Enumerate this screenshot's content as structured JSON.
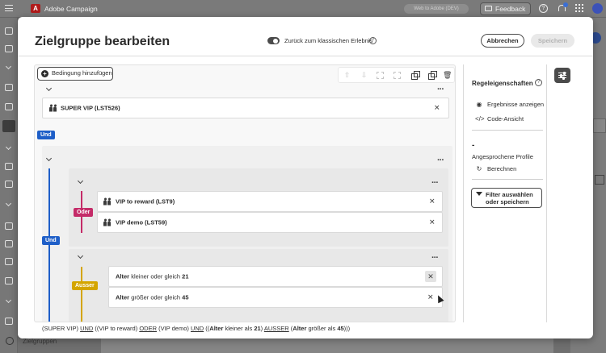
{
  "app": {
    "title": "Adobe Campaign",
    "org_selector": "Web to Adobe (DEV)",
    "feedback_label": "Feedback",
    "sidebar_bottom_label": "Zielgruppen"
  },
  "modal": {
    "title": "Zielgruppe bearbeiten",
    "toggle_label": "Zurück zum klassischen Erlebnis",
    "cancel_label": "Abbrechen",
    "save_label": "Speichern"
  },
  "canvas": {
    "add_condition_label": "Bedingung hinzufügen",
    "blocks": {
      "super_vip": {
        "label": "SUPER VIP (LST526)"
      },
      "und_badge_1": "Und",
      "und_badge_2": "Und",
      "oder_badge": "Oder",
      "vip_reward": {
        "label": "VIP to reward (LST9)"
      },
      "vip_demo": {
        "label": "VIP demo (LST59)"
      },
      "ausser_badge": "Ausser",
      "alter_1": {
        "field": "Alter",
        "op": "kleiner oder gleich",
        "value": "21"
      },
      "alter_2": {
        "field": "Alter",
        "op": "größer oder gleich",
        "value": "45"
      }
    }
  },
  "expression": {
    "p1": "(SUPER VIP) ",
    "und1": "UND",
    "p2": " ((VIP to reward) ",
    "oder": "ODER",
    "p3": " (VIP demo) ",
    "und2": "UND",
    "p4": " ((",
    "f1": "Alter",
    "o1": " kleiner als ",
    "v1": "21",
    "p5": ") ",
    "ausser": "AUSSER",
    "p6": " (",
    "f2": "Alter",
    "o2": " größer als ",
    "v2": "45",
    "p7": ")))"
  },
  "panel": {
    "title": "Regeleigenschaften",
    "show_results": "Ergebnisse anzeigen",
    "code_view": "Code-Ansicht",
    "profile_count": "-",
    "targeted_profiles": "Angesprochene Profile",
    "compute": "Berechnen",
    "filter_line1": "Filter auswählen",
    "filter_line2": "oder speichern"
  },
  "colors": {
    "und": "#1f5fc8",
    "oder": "#c42b68",
    "ausser": "#d4a500"
  }
}
